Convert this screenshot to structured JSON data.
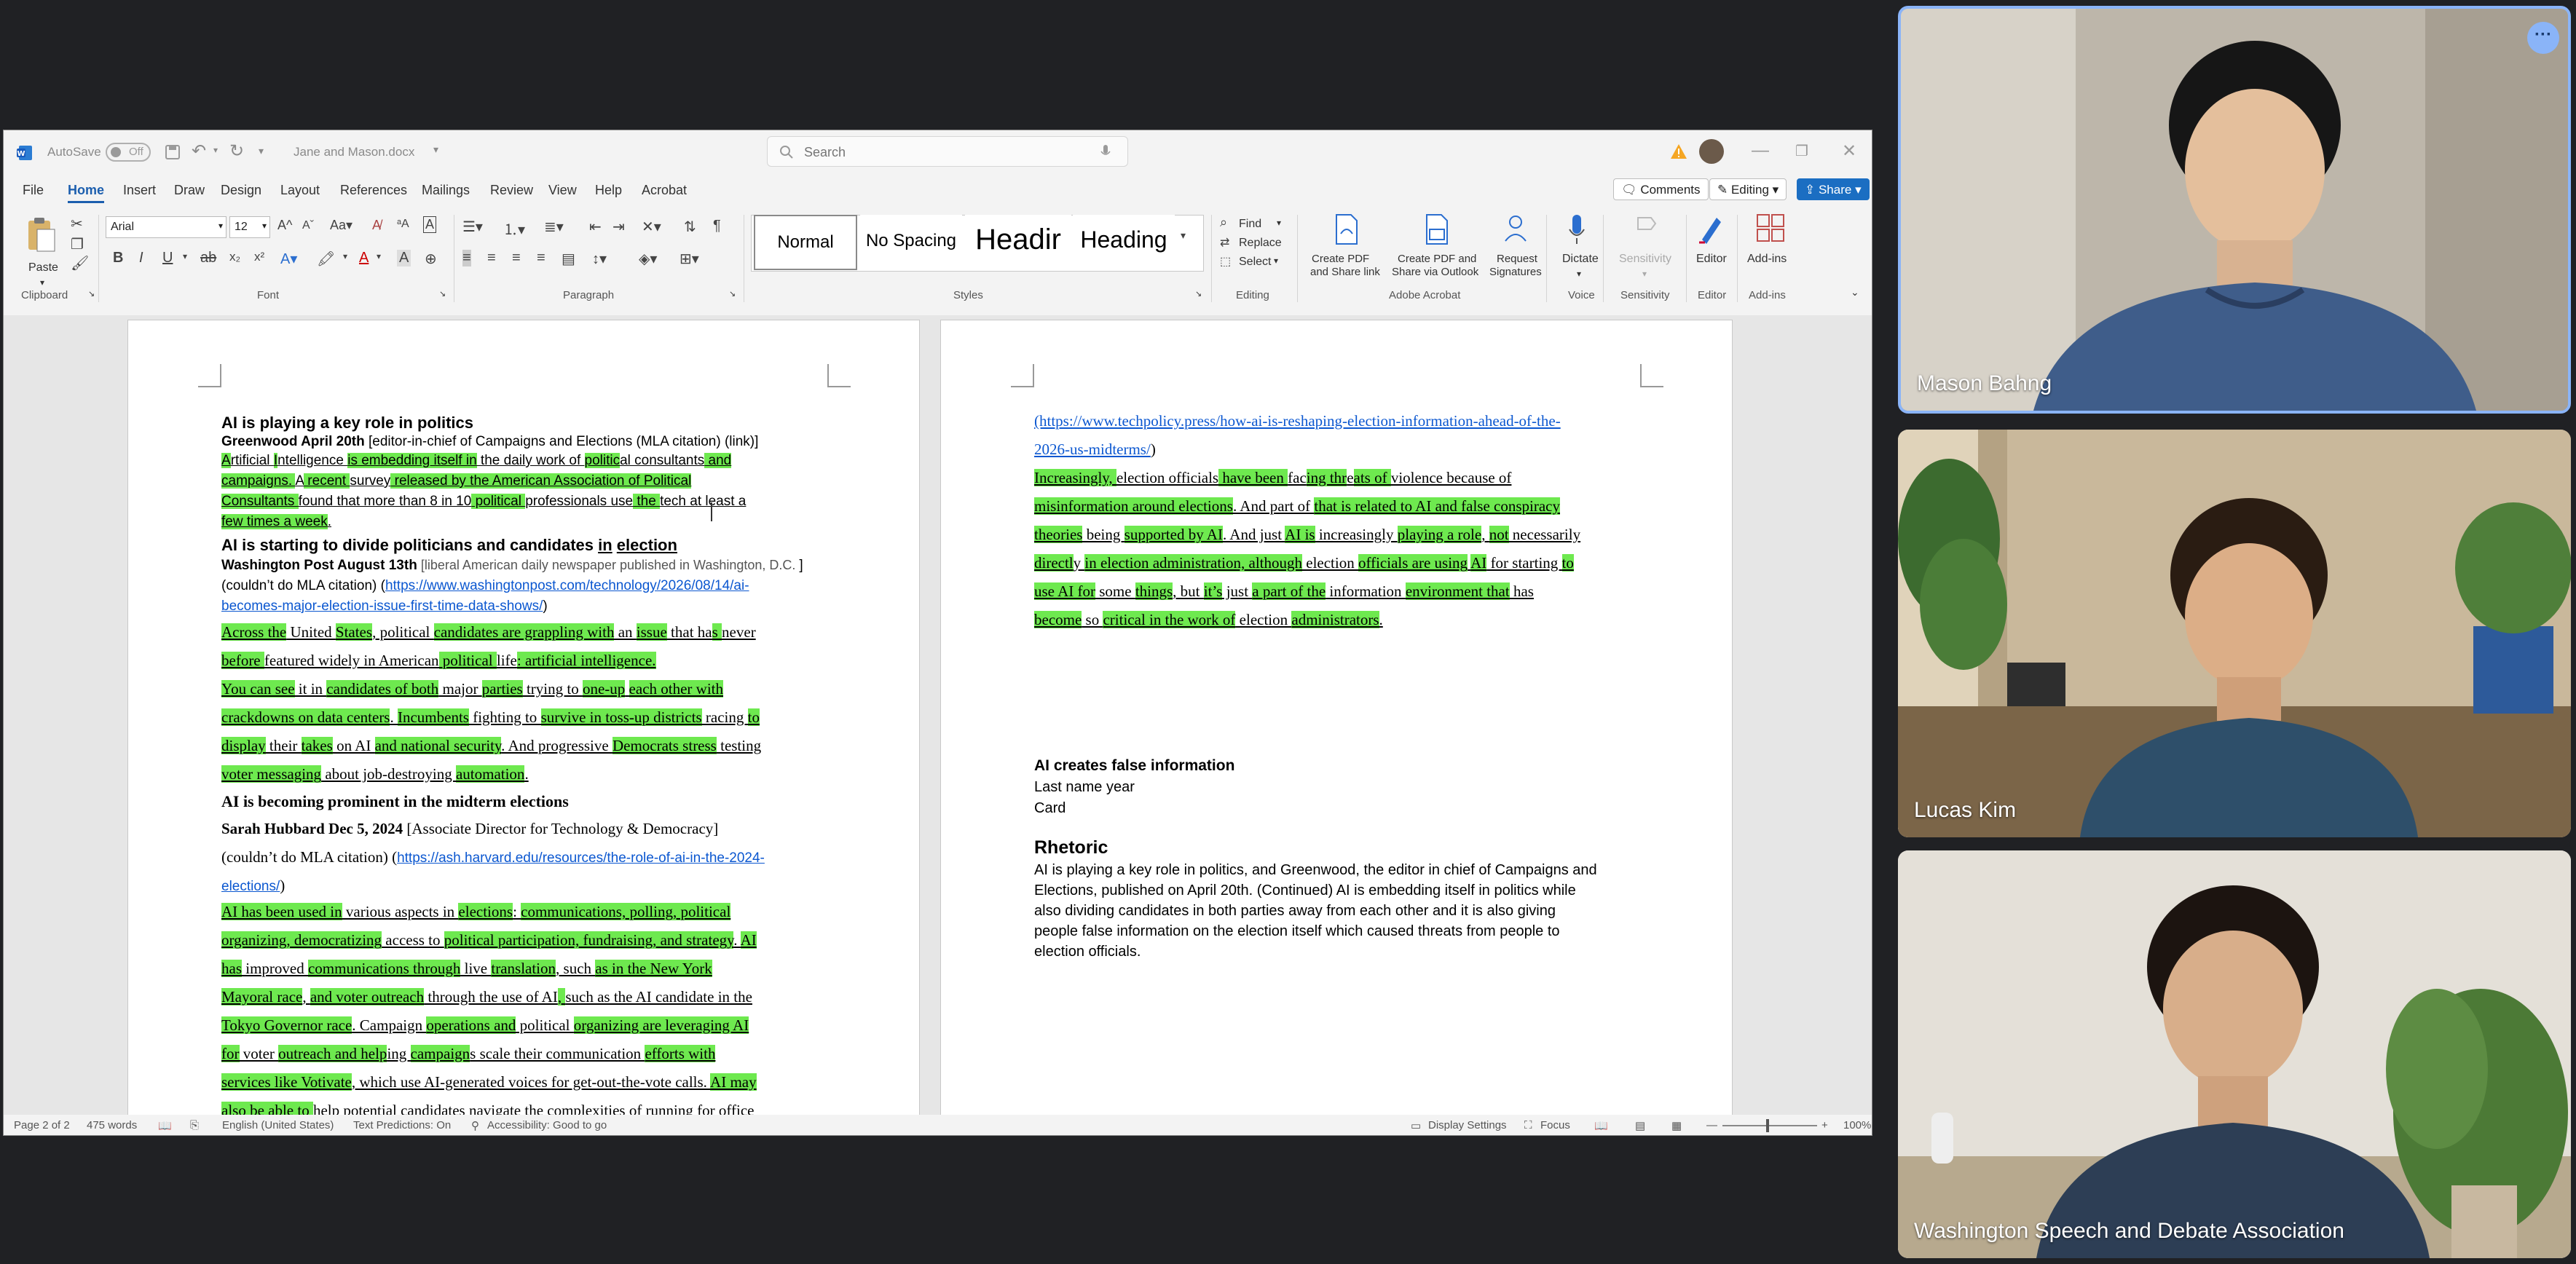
{
  "word": {
    "titlebar": {
      "autosave_label": "AutoSave",
      "autosave_state": "Off",
      "doc_title": "Jane and Mason.docx",
      "search_placeholder": "Search"
    },
    "menu": [
      "File",
      "Home",
      "Insert",
      "Draw",
      "Design",
      "Layout",
      "References",
      "Mailings",
      "Review",
      "View",
      "Help",
      "Acrobat"
    ],
    "menu_active": "Home",
    "right_buttons": {
      "comments": "Comments",
      "editing": "Editing",
      "share": "Share"
    },
    "ribbon": {
      "clipboard": {
        "paste": "Paste",
        "label": "Clipboard"
      },
      "font": {
        "name": "Arial",
        "size": "12",
        "label": "Font"
      },
      "paragraph": {
        "label": "Paragraph"
      },
      "styles": {
        "items": [
          "Normal",
          "No Spacing",
          "Headir",
          "Heading"
        ],
        "label": "Styles"
      },
      "editing": {
        "find": "Find",
        "replace": "Replace",
        "select": "Select",
        "label": "Editing"
      },
      "acrobat": {
        "create_pdf": [
          "Create PDF",
          "and Share link"
        ],
        "create_outlook": [
          "Create PDF and",
          "Share via Outlook"
        ],
        "request": [
          "Request",
          "Signatures"
        ],
        "label": "Adobe Acrobat"
      },
      "voice": {
        "dictate": "Dictate",
        "label": "Voice"
      },
      "sensitivity": {
        "btn": "Sensitivity",
        "label": "Sensitivity"
      },
      "editor": {
        "btn": "Editor",
        "label": "Editor"
      },
      "addins": {
        "btn": "Add-ins",
        "label": "Add-ins"
      }
    },
    "status": {
      "page": "Page 2 of 2",
      "words": "475 words",
      "language": "English (United States)",
      "predictions": "Text Predictions: On",
      "accessibility": "Accessibility: Good to go",
      "display": "Display Settings",
      "focus": "Focus",
      "zoom": "100%"
    }
  },
  "doc_left": {
    "h1": "AI is playing a key role in politics",
    "cite1_bold": "Greenwood April 20th",
    "cite1_rest": " [editor-in-chief of Campaigns and Elections (MLA citation) (link)]",
    "p1": [
      [
        "A",
        "rtificial ",
        "I",
        "ntelligence ",
        "is embedding itself in",
        " the daily work of ",
        "politic",
        "al consultants",
        " and"
      ],
      [
        "campaigns. ",
        "A",
        " recent ",
        "survey",
        " released by the American Association of Political"
      ],
      [
        "Consultants ",
        "found that more than 8 in 10",
        " political ",
        "professionals use",
        " the ",
        "tech at least a"
      ],
      [
        "few times a week",
        "."
      ]
    ],
    "h2a": "AI is starting to divide politicians and candidates ",
    "h2b": "in",
    "h2c": "election",
    "cite2_bold": "Washington Post August 13th",
    "cite2_gray": " [liberal American daily newspaper published in Washington, D.C. ",
    "cite2_end": "]",
    "cite2_line2a": "(couldn’t do MLA citation) (",
    "cite2_link1": "https://www.washingtonpost.com/technology/2026/08/14/ai-",
    "cite2_link2": "becomes-major-election-issue-first-time-data-shows/",
    "cite2_close": ")",
    "p2": [
      [
        "Across the",
        " United ",
        "States",
        ", political ",
        "candidates are grappling with",
        " an ",
        "issue",
        " that ha",
        "s ",
        "never"
      ],
      [
        "before ",
        "featured widely in American",
        " political ",
        "life",
        ": artificial intelligence."
      ],
      [
        "You can see",
        " it in ",
        "candidates of both",
        " major ",
        "parties",
        " trying to ",
        "one-up",
        " ",
        "each other with"
      ],
      [
        "crackdowns on data centers",
        ". ",
        "Incumbents",
        " fighting to ",
        "survive in toss-up districts",
        " racing ",
        "to"
      ],
      [
        "display",
        " their ",
        "takes",
        " on AI ",
        "and national security",
        ". And progressive ",
        "Democrats stress",
        " testing"
      ],
      [
        "voter messaging",
        " about job-destroying ",
        "automation",
        "."
      ]
    ],
    "h3": "AI is becoming prominent in the midterm elections",
    "cite3_bold": "Sarah Hubbard Dec 5, 2024",
    "cite3_rest": " [Associate Director for Technology & Democracy]",
    "cite3_line2a": "(couldn’t do MLA citation) (",
    "cite3_link1": "https://ash.harvard.edu/resources/the-role-of-ai-in-the-2024-",
    "cite3_link2": "elections/",
    "cite3_close": ")",
    "p3": [
      [
        "AI has been used in",
        " various aspects in ",
        "elections",
        ": ",
        "communications, polling, political"
      ],
      [
        "organizing, democratizing",
        " access to ",
        "political participation, fundraising, and strategy",
        ". ",
        "AI"
      ],
      [
        "has",
        " improved ",
        "communications through",
        " live ",
        "translation",
        ", such ",
        "as in the New York"
      ],
      [
        "Mayoral race",
        ", ",
        "and voter outreach",
        " through the use of AI",
        ", ",
        "such as the AI candidate in the"
      ],
      [
        "Tokyo Governor race",
        ". Campaign ",
        "operations and",
        " political ",
        "organizing are leveraging AI"
      ],
      [
        "for",
        " voter ",
        "outreach and help",
        "ing ",
        "campaign",
        "s scale their communication ",
        "efforts with"
      ],
      [
        "services like Votivate",
        ", which use AI-generated voices for get-out-the-vote calls. ",
        "AI may"
      ],
      [
        "also be able to ",
        "help potential candidates navigate the complexities of running for office"
      ]
    ]
  },
  "doc_right": {
    "link1": "(https://www.techpolicy.press/how-ai-is-reshaping-election-information-ahead-of-the-",
    "link2": "2026-us-midterms/",
    "link_close": ")",
    "p": [
      [
        "Increasingly, ",
        "election officials",
        " have been ",
        "fac",
        "ing thr",
        "e",
        "ats of ",
        "violence because of"
      ],
      [
        "misinformation around elections",
        ". And part of ",
        "that is related to AI and false conspiracy"
      ],
      [
        "theories",
        " being ",
        "supported by AI",
        ". And just ",
        "AI is",
        " increasingly ",
        "playing a role",
        ", ",
        "not",
        " necessarily"
      ],
      [
        "directl",
        "y ",
        "in election administration, although",
        " election ",
        "officials are using",
        " ",
        "AI",
        " for starting ",
        "to"
      ],
      [
        "use AI for",
        " some ",
        "things",
        ", but ",
        "it’s",
        " just ",
        "a part of the",
        " information ",
        "environment that",
        " has"
      ],
      [
        "become",
        " so ",
        "critical in the work of",
        " election ",
        "administrators",
        "."
      ]
    ],
    "h_card": "AI creates false information",
    "card_line1": "Last name year",
    "card_line2": "Card",
    "h_rhetoric": "Rhetoric",
    "rhetoric": [
      "AI is playing a key role in politics, and Greenwood, the editor in chief of Campaigns and",
      "Elections, published on April 20th. (Continued) AI is embedding itself in politics while",
      "also dividing candidates in both parties away from each other and it is also giving",
      "people false information on the election itself which caused threats from people to",
      "election officials."
    ],
    "rhetoric_sup": "th"
  },
  "participants": [
    {
      "name": "Mason Bahng"
    },
    {
      "name": "Lucas Kim"
    },
    {
      "name": "Washington Speech and Debate Association"
    }
  ],
  "colors": {
    "highlight": "#6ee94f",
    "link": "#0b57d0",
    "accent": "#1b6ec2",
    "active_speaker": "#8ab4f8"
  }
}
